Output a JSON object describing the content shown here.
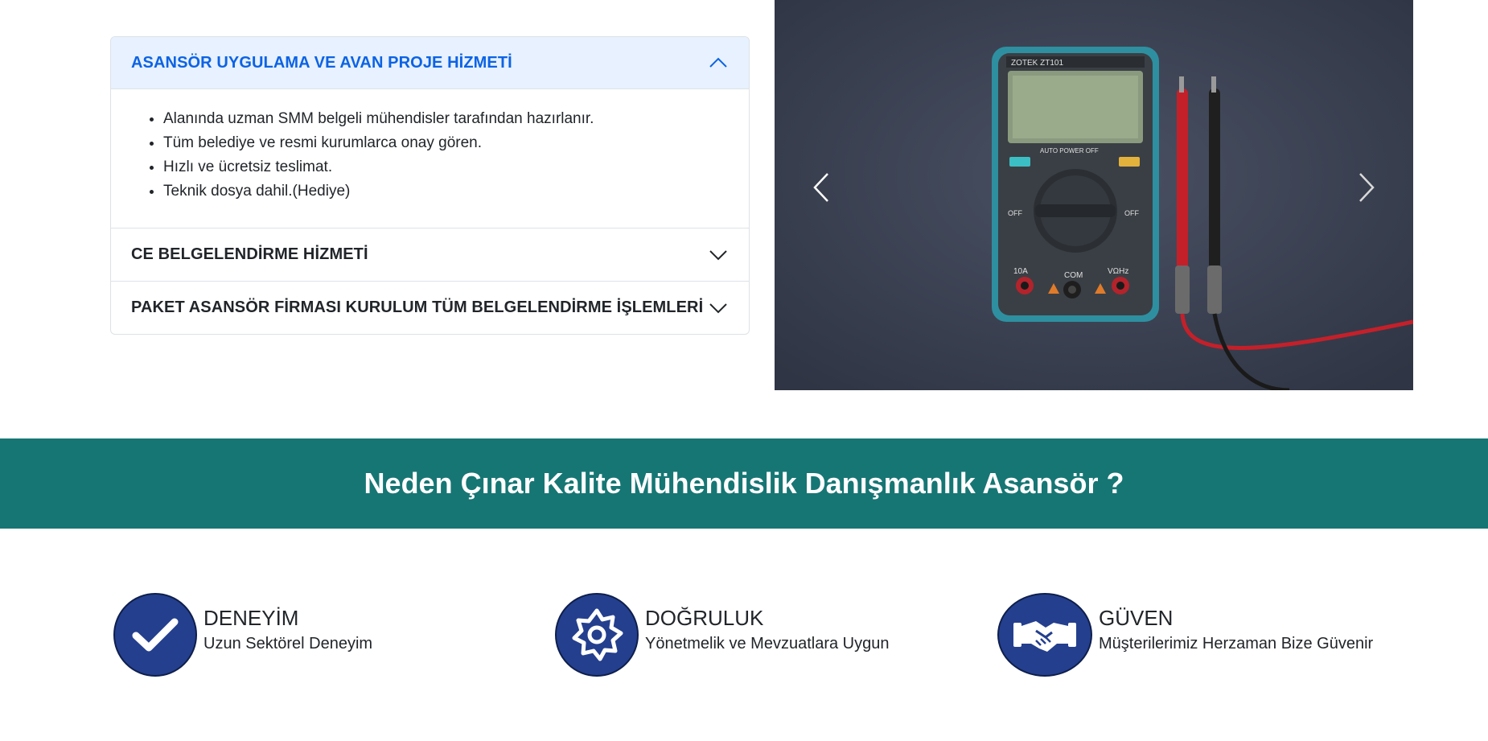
{
  "accordion": {
    "items": [
      {
        "title": "ASANSÖR UYGULAMA VE AVAN PROJE HİZMETİ",
        "expanded": true,
        "bullets": [
          "Alanında uzman SMM belgeli mühendisler tarafından hazırlanır.",
          "Tüm belediye ve resmi kurumlarca onay gören.",
          "Hızlı ve ücretsiz teslimat.",
          "Teknik dosya dahil.(Hediye)"
        ]
      },
      {
        "title": "CE BELGELENDİRME HİZMETİ",
        "expanded": false
      },
      {
        "title": "PAKET ASANSÖR FİRMASI KURULUM TÜM BELGELENDİRME İŞLEMLERİ",
        "expanded": false
      }
    ]
  },
  "carousel": {
    "image": "multimeter-photo",
    "prev_icon": "chevron-left-icon",
    "next_icon": "chevron-right-icon"
  },
  "banner": {
    "heading": "Neden Çınar Kalite Mühendislik Danışmanlık Asansör ?",
    "color": "#167674"
  },
  "features": [
    {
      "icon": "checkmark-icon",
      "title": "DENEYİM",
      "subtitle": "Uzun Sektörel Deneyim"
    },
    {
      "icon": "gear-icon",
      "title": "DOĞRULUK",
      "subtitle": "Yönetmelik ve Mevzuatlara Uygun"
    },
    {
      "icon": "handshake-icon",
      "title": "GÜVEN",
      "subtitle": "Müşterilerimiz Herzaman Bize Güvenir"
    }
  ],
  "colors": {
    "accent_blue": "#0c63e4",
    "open_header_bg": "#e7f1ff",
    "icon_circle": "#243f8e"
  }
}
